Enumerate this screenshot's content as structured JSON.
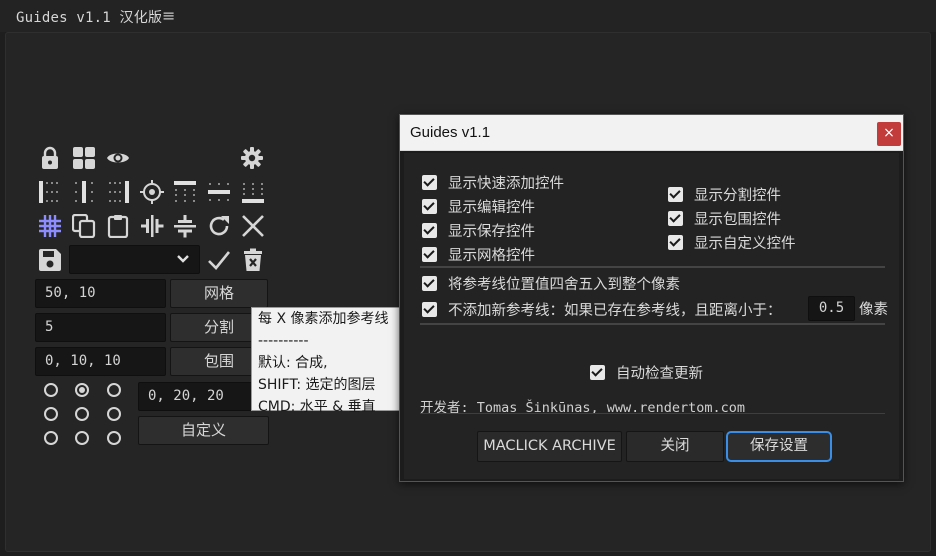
{
  "panel": {
    "title": "Guides v1.1 汉化版",
    "menu_icon": "hamburger-menu-icon"
  },
  "toolbar": {
    "row1": [
      "lock-icon",
      "grid-tiles-icon",
      "eye-icon",
      "gear-icon"
    ],
    "row2": [
      "guide-left-edge-icon",
      "guide-vertical-center-icon",
      "guide-right-edge-icon",
      "target-center-icon",
      "guide-top-edge-icon",
      "guide-horizontal-center-icon",
      "guide-bottom-edge-icon"
    ],
    "row3": [
      "grid-hash-icon",
      "duplicate-icon",
      "clipboard-icon",
      "flip-horizontal-icon",
      "flip-vertical-icon",
      "refresh-icon",
      "clear-x-icon"
    ],
    "row4": [
      "save-icon",
      "apply-check-icon",
      "delete-trash-icon"
    ],
    "preset_select_value": ""
  },
  "inputs": {
    "grid_value": "50, 10",
    "split_value": "5",
    "margin_value": "0, 10, 10",
    "custom_value": "0, 20, 20"
  },
  "buttons": {
    "grid": "网格",
    "split": "分割",
    "margin": "包围",
    "custom": "自定义"
  },
  "anchor_grid": {
    "selected_index": 1
  },
  "tooltip": {
    "lines": [
      "每 X 像素添加参考线",
      "----------",
      "默认: 合成,",
      "SHIFT: 选定的图层",
      "CMD: 水平 & 垂直"
    ]
  },
  "dialog": {
    "title": "Guides v1.1",
    "close_label": "×",
    "left_checks": [
      "显示快速添加控件",
      "显示编辑控件",
      "显示保存控件",
      "显示网格控件"
    ],
    "right_checks": [
      "显示分割控件",
      "显示包围控件",
      "显示自定义控件"
    ],
    "round_option": "将参考线位置值四舍五入到整个像素",
    "no_dup_option": "不添加新参考线：如果已存在参考线，且距离小于：",
    "tolerance_value": "0.5",
    "tolerance_unit": "像素",
    "auto_update": "自动检查更新",
    "developer": "开发者: Tomas Šinkūnas, www.rendertom.com",
    "btn_archive": "MACLICK ARCHIVE",
    "btn_close": "关闭",
    "btn_save": "保存设置"
  },
  "colors": {
    "accent_grid_icon": "#8c8cff",
    "primary_outline": "#3a8ee6",
    "close_button": "#c33c3c"
  }
}
